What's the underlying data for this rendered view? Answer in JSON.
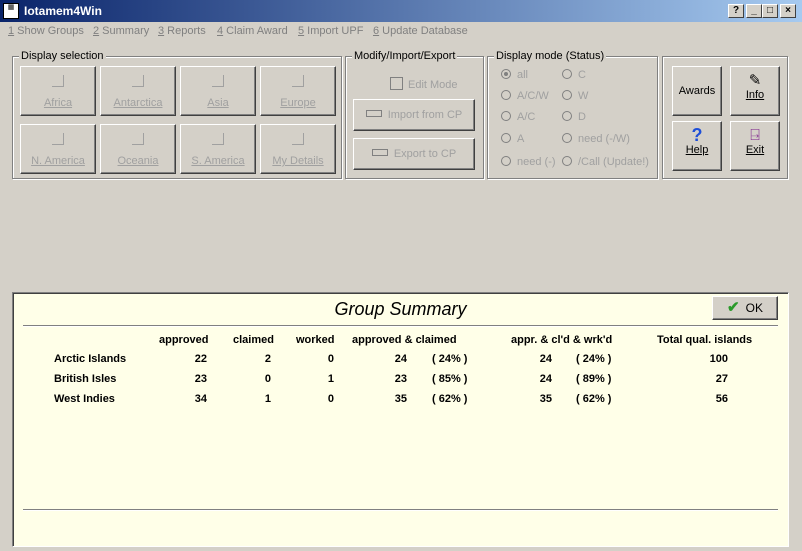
{
  "window": {
    "title": "Iotamem4Win",
    "icon": "app-icon",
    "buttons": {
      "help": "?",
      "minimize": "_",
      "maximize": "□",
      "close": "×"
    }
  },
  "menu": [
    {
      "key": "1",
      "label": " Show Groups"
    },
    {
      "key": "2",
      "label": " Summary"
    },
    {
      "key": "3",
      "label": " Reports"
    },
    {
      "key": "4",
      "label": " Claim Award"
    },
    {
      "key": "5",
      "label": " Import UPF"
    },
    {
      "key": "6",
      "label": " Update Database"
    }
  ],
  "display_selection": {
    "legend": "Display selection",
    "buttons": [
      "Africa",
      "Antarctica",
      "Asia",
      "Europe",
      "N. America",
      "Oceania",
      "S. America",
      "My Details"
    ]
  },
  "modify": {
    "legend": "Modify/Import/Export",
    "edit_mode": "Edit Mode",
    "import_label": "Import from CP",
    "export_label": "Export to CP"
  },
  "display_mode": {
    "legend": "Display mode (Status)",
    "options_left": [
      "all",
      "A/C/W",
      "A/C",
      "A",
      "need (-)"
    ],
    "options_right": [
      "C",
      "W",
      "D",
      "need (-/W)",
      "/Call (Update!)"
    ],
    "selected": "all"
  },
  "tools": {
    "awards": "Awards",
    "info": "Info",
    "help": "Help",
    "exit": "Exit"
  },
  "summary": {
    "title": "Group Summary",
    "ok_label": "OK",
    "headers": {
      "approved": "approved",
      "claimed": "claimed",
      "worked": "worked",
      "approved_claimed": "approved & claimed",
      "appr_cld_wrkd": "appr. & cl'd & wrk'd",
      "total": "Total qual. islands"
    },
    "rows": [
      {
        "group": "Arctic Islands",
        "approved": "22",
        "claimed": "2",
        "worked": "0",
        "ac": "24",
        "ac_pct": "( 24% )",
        "acw": "24",
        "acw_pct": "( 24% )",
        "total": "100"
      },
      {
        "group": "British Isles",
        "approved": "23",
        "claimed": "0",
        "worked": "1",
        "ac": "23",
        "ac_pct": "( 85% )",
        "acw": "24",
        "acw_pct": "( 89% )",
        "total": "27"
      },
      {
        "group": "West Indies",
        "approved": "34",
        "claimed": "1",
        "worked": "0",
        "ac": "35",
        "ac_pct": "( 62% )",
        "acw": "35",
        "acw_pct": "( 62% )",
        "total": "56"
      }
    ]
  }
}
